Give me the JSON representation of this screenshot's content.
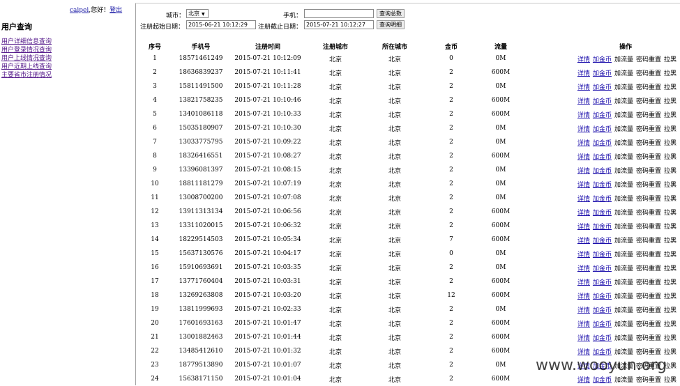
{
  "left": {
    "username": "caipei",
    "greeting": ",您好！",
    "logout": "登出",
    "menu_title": "用户查询",
    "menu": [
      "用户详细信息查询",
      "用户登录情况查询",
      "用户上线情况查询",
      "用户近期上线查询",
      "主要省市注册情况"
    ]
  },
  "filters": {
    "city_label": "城市：",
    "city_value": "北京",
    "phone_label": "手机：",
    "phone_value": "",
    "search_total": "查询总数",
    "start_label": "注册起始日期：",
    "start_value": "2015-06-21 10:12:29",
    "end_label": "注册截止日期：",
    "end_value": "2015-07-21 10:12:27",
    "search_detail": "查询明细"
  },
  "table": {
    "headers": [
      "序号",
      "手机号",
      "注册时间",
      "注册城市",
      "所在城市",
      "金币",
      "流量",
      "操作"
    ],
    "ops": [
      "详情",
      "加金币",
      "加流量",
      "密码重置",
      "拉黑"
    ],
    "rows": [
      [
        "1",
        "18571461249",
        "2015-07-21 10:12:09",
        "北京",
        "北京",
        "0",
        "0M"
      ],
      [
        "2",
        "18636839237",
        "2015-07-21 10:11:41",
        "北京",
        "北京",
        "2",
        "600M"
      ],
      [
        "3",
        "15811491500",
        "2015-07-21 10:11:28",
        "北京",
        "北京",
        "2",
        "0M"
      ],
      [
        "4",
        "13821758235",
        "2015-07-21 10:10:46",
        "北京",
        "北京",
        "2",
        "600M"
      ],
      [
        "5",
        "13401086118",
        "2015-07-21 10:10:33",
        "北京",
        "北京",
        "2",
        "600M"
      ],
      [
        "6",
        "15035180907",
        "2015-07-21 10:10:30",
        "北京",
        "北京",
        "2",
        "0M"
      ],
      [
        "7",
        "13033775795",
        "2015-07-21 10:09:22",
        "北京",
        "北京",
        "2",
        "0M"
      ],
      [
        "8",
        "18326416551",
        "2015-07-21 10:08:27",
        "北京",
        "北京",
        "2",
        "600M"
      ],
      [
        "9",
        "13396081397",
        "2015-07-21 10:08:15",
        "北京",
        "北京",
        "2",
        "0M"
      ],
      [
        "10",
        "18811181279",
        "2015-07-21 10:07:19",
        "北京",
        "北京",
        "2",
        "0M"
      ],
      [
        "11",
        "13008700200",
        "2015-07-21 10:07:08",
        "北京",
        "北京",
        "2",
        "0M"
      ],
      [
        "12",
        "13911313134",
        "2015-07-21 10:06:56",
        "北京",
        "北京",
        "2",
        "600M"
      ],
      [
        "13",
        "13311020015",
        "2015-07-21 10:06:32",
        "北京",
        "北京",
        "2",
        "600M"
      ],
      [
        "14",
        "18229514503",
        "2015-07-21 10:05:34",
        "北京",
        "北京",
        "7",
        "600M"
      ],
      [
        "15",
        "15637130576",
        "2015-07-21 10:04:17",
        "北京",
        "北京",
        "0",
        "0M"
      ],
      [
        "16",
        "15910693691",
        "2015-07-21 10:03:35",
        "北京",
        "北京",
        "2",
        "0M"
      ],
      [
        "17",
        "13771760404",
        "2015-07-21 10:03:31",
        "北京",
        "北京",
        "2",
        "600M"
      ],
      [
        "18",
        "13269263808",
        "2015-07-21 10:03:20",
        "北京",
        "北京",
        "12",
        "600M"
      ],
      [
        "19",
        "13811999693",
        "2015-07-21 10:02:33",
        "北京",
        "北京",
        "2",
        "0M"
      ],
      [
        "20",
        "17601693163",
        "2015-07-21 10:01:47",
        "北京",
        "北京",
        "2",
        "600M"
      ],
      [
        "21",
        "13001882463",
        "2015-07-21 10:01:44",
        "北京",
        "北京",
        "2",
        "600M"
      ],
      [
        "22",
        "13485412610",
        "2015-07-21 10:01:32",
        "北京",
        "北京",
        "2",
        "600M"
      ],
      [
        "23",
        "18779513890",
        "2015-07-21 10:01:07",
        "北京",
        "北京",
        "2",
        "0M"
      ],
      [
        "24",
        "15638171150",
        "2015-07-21 10:01:04",
        "北京",
        "北京",
        "2",
        "600M"
      ]
    ]
  },
  "watermark": "www.wooyun.org"
}
